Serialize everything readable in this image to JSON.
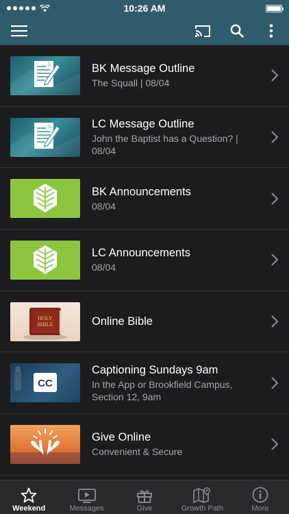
{
  "status_bar": {
    "time": "10:26 AM"
  },
  "app_bar": {
    "icons": [
      "menu-icon",
      "cast-icon",
      "search-icon",
      "more-vertical-icon"
    ]
  },
  "items": [
    {
      "title": "BK Message Outline",
      "subtitle": "The Squall | 08/04",
      "thumb": "document-icon"
    },
    {
      "title": "LC Message Outline",
      "subtitle": "John the Baptist has a Question? | 08/04",
      "thumb": "document-icon"
    },
    {
      "title": "BK Announcements",
      "subtitle": "08/04",
      "thumb": "church-logo-icon"
    },
    {
      "title": "LC Announcements",
      "subtitle": "08/04",
      "thumb": "church-logo-icon"
    },
    {
      "title": "Online Bible",
      "subtitle": "",
      "thumb": "bible-icon",
      "thumb_text": "HOLY BIBLE"
    },
    {
      "title": "Captioning Sundays 9am",
      "subtitle": "In the App or Brookfield Campus, Section 12, 9am",
      "thumb": "cc-icon",
      "thumb_text": "CC"
    },
    {
      "title": "Give Online",
      "subtitle": "Convenient & Secure",
      "thumb": "giving-hands-icon"
    }
  ],
  "tabs": [
    {
      "label": "Weekend",
      "icon": "star-icon",
      "active": true
    },
    {
      "label": "Messages",
      "icon": "video-icon",
      "active": false
    },
    {
      "label": "Give",
      "icon": "gift-icon",
      "active": false
    },
    {
      "label": "Growth Path",
      "icon": "map-pin-icon",
      "active": false
    },
    {
      "label": "More",
      "icon": "info-icon",
      "active": false
    }
  ],
  "colors": {
    "app_bar": "#2f5b6a",
    "background": "#1c1c1e",
    "accent_green": "#8cc63f"
  }
}
